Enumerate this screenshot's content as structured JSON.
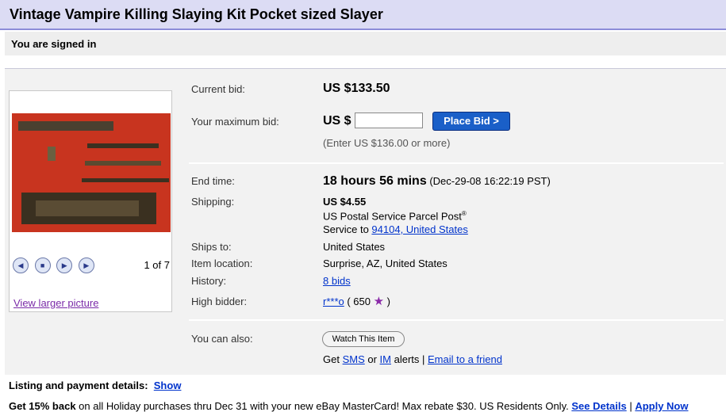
{
  "title": "Vintage Vampire Killing Slaying Kit Pocket sized Slayer",
  "signed_in": "You are signed in",
  "gallery": {
    "counter": "1 of 7",
    "view_larger": "View larger picture"
  },
  "bid": {
    "current_label": "Current bid:",
    "current_value": "US $133.50",
    "max_label": "Your maximum bid:",
    "currency": "US $",
    "input_value": "",
    "button": "Place Bid >",
    "hint": "(Enter US $136.00 or more)"
  },
  "details": {
    "end_label": "End time:",
    "end_value": "18 hours 56 mins",
    "end_date": "(Dec-29-08 16:22:19 PST)",
    "shipping_label": "Shipping:",
    "shipping_cost": "US $4.55",
    "shipping_service": "US Postal Service Parcel Post",
    "shipping_reg": "®",
    "service_to_prefix": "Service to ",
    "service_to_link": "94104, United States",
    "ships_to_label": "Ships to:",
    "ships_to_value": "United States",
    "location_label": "Item location:",
    "location_value": "Surprise, AZ, United States",
    "history_label": "History:",
    "history_value": "8 bids",
    "bidder_label": "High bidder:",
    "bidder_name": "r***o",
    "bidder_score_open": " ( 650 ",
    "bidder_score_close": " )",
    "star_icon": "purple-star-icon"
  },
  "also": {
    "label": "You can also:",
    "watch": "Watch This Item",
    "get": "Get ",
    "sms": "SMS",
    "or": " or ",
    "im": "IM",
    "alerts": " alerts | ",
    "email": "Email to a friend"
  },
  "listing": {
    "label": "Listing and payment details:",
    "show": "Show"
  },
  "promo": {
    "bold": "Get 15% back",
    "text": " on all Holiday purchases thru Dec 31 with your new eBay MasterCard! Max rebate $30. US Residents Only. ",
    "details": "See Details",
    "sep": " | ",
    "apply": "Apply Now"
  }
}
